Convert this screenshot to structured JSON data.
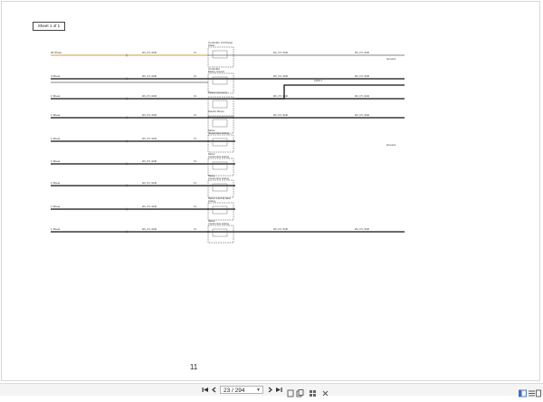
{
  "document": {
    "sheet_label": "Sheet 1 of 1",
    "page_number": "11"
  },
  "toolbar": {
    "first_page_icon": "skip-back-icon",
    "prev_page_icon": "chevron-left-icon",
    "current_page": "23",
    "total_pages": "294",
    "page_indicator": "23 / 294",
    "next_page_icon": "chevron-right-icon",
    "last_page_icon": "skip-forward-icon",
    "icons_right": [
      "fit-page-icon",
      "copy-icon",
      "thumbnails-icon",
      "close-icon",
      "sidebar-icon",
      "list-icon",
      "layout-icon"
    ]
  },
  "schematic": {
    "components": [
      {
        "label": "Controller Ctrl Panel",
        "sub": "Power"
      },
      {
        "label": "Controller",
        "sub": "Battery Ground"
      },
      {
        "label": "Panel connector",
        "sub": ""
      },
      {
        "label": "Switch Sheet",
        "sub": ""
      },
      {
        "label": "Motor",
        "sub": "Control door locking"
      },
      {
        "label": "Motor",
        "sub": "Control door locking"
      },
      {
        "label": "Motor",
        "sub": "Control door locking"
      },
      {
        "label": "Motor Control door",
        "sub": "locking"
      },
      {
        "label": "Motor",
        "sub": "Control door locking"
      }
    ],
    "wires": [
      {
        "left": "30 Sheet",
        "right": "Ground",
        "mid": "Ws, 0.5, 1040"
      },
      {
        "left": "4 Sheet",
        "right": "",
        "mid": "Ws, 0.5, 1040"
      },
      {
        "left": "1 Sheet",
        "right": "",
        "mid": "Ws, 0.5, 1040"
      },
      {
        "left": "1 Sheet",
        "right": "",
        "mid": "Ws, 0.5, 1040"
      },
      {
        "left": "1 Sheet",
        "right": "Ground",
        "mid": "Ws, 0.5, 1040"
      },
      {
        "left": "1 Sheet",
        "right": "",
        "mid": "Ws, 0.5, 1040"
      },
      {
        "left": "1 Sheet",
        "right": "",
        "mid": "Ws, 0.5, 1040"
      },
      {
        "left": "1 Sheet",
        "right": "",
        "mid": "Ws, 0.5, 1040"
      },
      {
        "left": "1 Sheet",
        "right": "",
        "mid": "Ws, 0.5, 1040"
      },
      {
        "left": "1 Sheet",
        "right": "Ground",
        "mid": "Ws, 0.5, 1040"
      }
    ]
  }
}
